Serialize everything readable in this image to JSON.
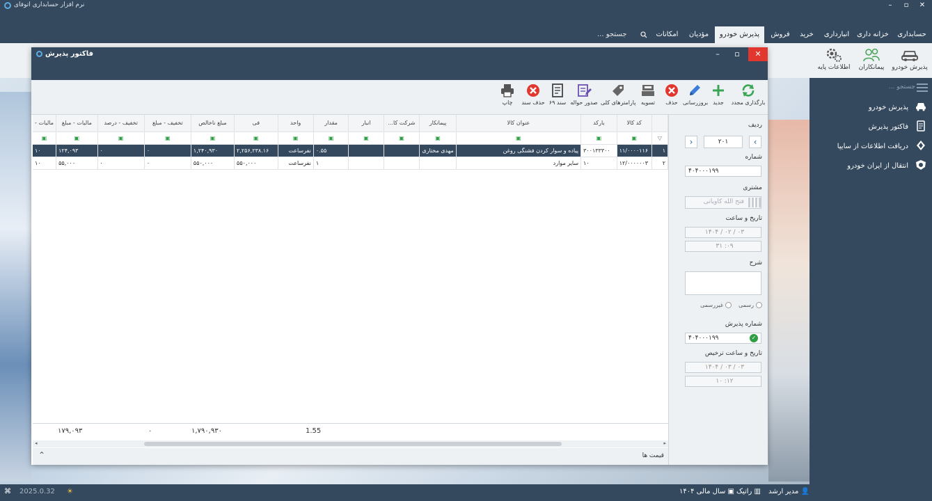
{
  "app": {
    "title": "نرم افزار حسابداری اتوفای",
    "minimize": "–",
    "restore": "▫",
    "close": "✕"
  },
  "menu": {
    "items": [
      "حسابداری",
      "خزانه داری",
      "انبارداری",
      "خرید",
      "فروش",
      "پذیرش خودرو",
      "مؤدیان",
      "امکانات"
    ],
    "search_label": "جستجو ..."
  },
  "ribbon": {
    "buttons": [
      "پذیرش خودرو",
      "پیمانکاران",
      "اطلاعات پایه"
    ]
  },
  "sidebar": {
    "search_placeholder": "جستجو ...",
    "items": [
      "پذیرش خودرو",
      "فاکتور پذیرش",
      "دریافت اطلاعات از سایپا",
      "انتقال از ایران خودرو"
    ]
  },
  "dialog": {
    "title": "فاکتور پذیرش",
    "toolbar": [
      "بارگذاری مجدد",
      "جدید",
      "بروزرسانی",
      "حذف",
      "تسویه",
      "پارامترهای کلی",
      "صدور حواله",
      "سند ۶۹",
      "حذف سند",
      "چاپ"
    ],
    "panel": {
      "row_label": "ردیف",
      "row_value": "۲۰۱",
      "number_label": "شماره",
      "number_value": "۴۰۴۰۰۰۱۹۹",
      "customer_label": "مشتری",
      "customer_value": "فتح الله کاویانی",
      "datetime_label": "تاریخ و ساعت",
      "date_year": "۱۴۰۴",
      "date_month": "۰۲",
      "date_day": "۰۳",
      "time_value": "۰۹: ۳۱",
      "desc_label": "شرح",
      "radio_official": "رسمی",
      "radio_unofficial": "غیررسمی",
      "reception_label": "شماره پذیرش",
      "reception_value": "۴۰۴۰۰۰۱۹۹",
      "release_label": "تاریخ و ساعت ترخیص",
      "release_year": "۱۴۰۴",
      "release_month": "۰۳",
      "release_day": "۰۳",
      "release_time": "۱۲: ۱۰"
    },
    "grid": {
      "headers": [
        "",
        "کد کالا",
        "بارکد",
        "عنوان کالا",
        "پیمانکار",
        "شرکت کا...",
        "انبار",
        "مقدار",
        "واحد",
        "فی",
        "مبلغ ناخالص",
        "تخفیف - مبلغ",
        "تخفیف - درصد",
        "مالیات - مبلغ",
        "مالیات -"
      ],
      "filter_mark": "▣",
      "rows": [
        {
          "index": "۱",
          "code": "۱۱/۰۰۰۰۱۱۶",
          "barcode": "۳۰۰۱۳۳۳۰۰",
          "title": "پیاده و سوار کردن فشنگی روغن",
          "contractor": "مهدی مختاری",
          "company": "",
          "warehouse": "",
          "qty": "۰.۵۵",
          "unit": "نفرساعت",
          "fee": "۲,۲۵۶,۲۳۸.۱۶",
          "gross": "۱,۲۴۰,۹۳۰",
          "disc_amount": "۰",
          "disc_percent": "۰",
          "tax_amount": "۱۲۴,۰۹۳",
          "tax_rate": "۱۰"
        },
        {
          "index": "۲",
          "code": "۱۲/۰۰۰۰۰۰۳",
          "barcode": "۱۰",
          "title": "سایر موارد",
          "contractor": "",
          "company": "",
          "warehouse": "",
          "qty": "۱",
          "unit": "نفرساعت",
          "fee": "۵۵۰,۰۰۰",
          "gross": "۵۵۰,۰۰۰",
          "disc_amount": "۰",
          "disc_percent": "۰",
          "tax_amount": "۵۵,۰۰۰",
          "tax_rate": "۱۰"
        }
      ],
      "totals": {
        "qty": "1.55",
        "gross": "۱,۷۹۰,۹۳۰",
        "disc": "۰",
        "tax": "۱۷۹,۰۹۳"
      },
      "prices_label": "قیمت ها"
    }
  },
  "status": {
    "user": "مدیر ارشد",
    "company": "راتیک",
    "fiscal_year": "سال مالی ۱۴۰۴",
    "version": "2025.0.32"
  },
  "colors": {
    "primary": "#34495e",
    "close": "#e2372f",
    "accent_green": "#2e9e44",
    "accent_blue": "#2c5aa0"
  }
}
